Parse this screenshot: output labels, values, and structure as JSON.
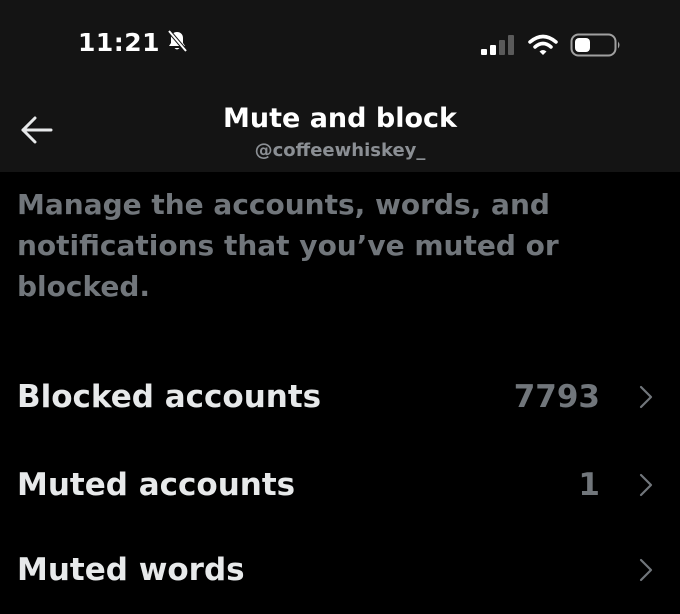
{
  "status_bar": {
    "time": "11:21",
    "icons": [
      "bell-slash-icon",
      "cellular-signal-icon",
      "wifi-icon",
      "battery-icon"
    ]
  },
  "header": {
    "title": "Mute and block",
    "subtitle": "@coffeewhiskey_",
    "back_icon": "arrow-left-icon"
  },
  "description": "Manage the accounts, words, and notifications that you’ve muted or blocked.",
  "rows": [
    {
      "label": "Blocked accounts",
      "count": "7793",
      "icon": "chevron-right-icon"
    },
    {
      "label": "Muted accounts",
      "count": "1",
      "icon": "chevron-right-icon"
    },
    {
      "label": "Muted words",
      "count": "",
      "icon": "chevron-right-icon"
    }
  ],
  "colors": {
    "background": "#000000",
    "header_background": "#141414",
    "primary_text": "#e7e9ea",
    "secondary_text": "#71767b"
  }
}
